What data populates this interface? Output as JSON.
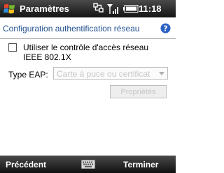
{
  "titlebar": {
    "title": "Paramètres",
    "time": "11:18",
    "icons": [
      "windows-start-icon",
      "connectivity-icon",
      "signal-icon",
      "battery-icon"
    ]
  },
  "page": {
    "title": "Configuration authentification réseau",
    "help_icon": "help-icon"
  },
  "form": {
    "checkbox_label": "Utiliser le contrôle d'accès réseau IEEE 802.1X",
    "checkbox_checked": false,
    "eap_label": "Type EAP:",
    "eap_value": "Carte à puce ou certificat",
    "properties_button": "Propriétés"
  },
  "softkeys": {
    "left": "Précédent",
    "right": "Terminer",
    "center_icon": "keyboard-icon"
  },
  "colors": {
    "bar": "#1a1a1a",
    "title_text": "#1f4e8f",
    "disabled_text": "#c6c6c6"
  }
}
